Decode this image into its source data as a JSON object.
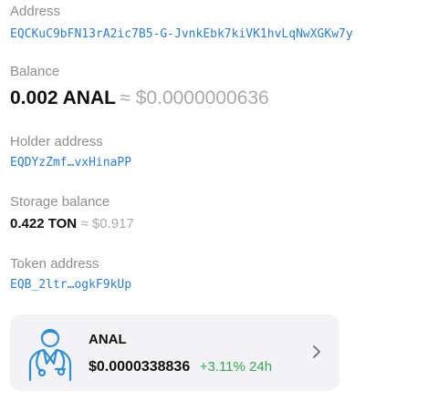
{
  "address": {
    "label": "Address",
    "value": "EQCKuC9bFN13rA2ic7B5-G-JvnkEbk7kiVK1hvLqNwXGKw7y"
  },
  "balance": {
    "label": "Balance",
    "amount": "0.002 ANAL",
    "approx": "≈ $0.0000000636"
  },
  "holder": {
    "label": "Holder address",
    "value": "EQDYzZmf…vxHinaPP"
  },
  "storage": {
    "label": "Storage balance",
    "amount": "0.422 TON",
    "approx": "≈ $0.917"
  },
  "token": {
    "label": "Token address",
    "value": "EQB_2ltr…ogkF9kUp"
  },
  "token_card": {
    "name": "ANAL",
    "price": "$0.0000338836",
    "change": "+3.11% 24h",
    "avatar_icon": "doctor-icon",
    "chevron_icon": "chevron-right-icon"
  },
  "colors": {
    "link": "#2a7fd4",
    "positive": "#34a853",
    "muted": "#8e8e93",
    "card_bg": "#f3f3f5",
    "avatar": "#2d8fd6"
  }
}
